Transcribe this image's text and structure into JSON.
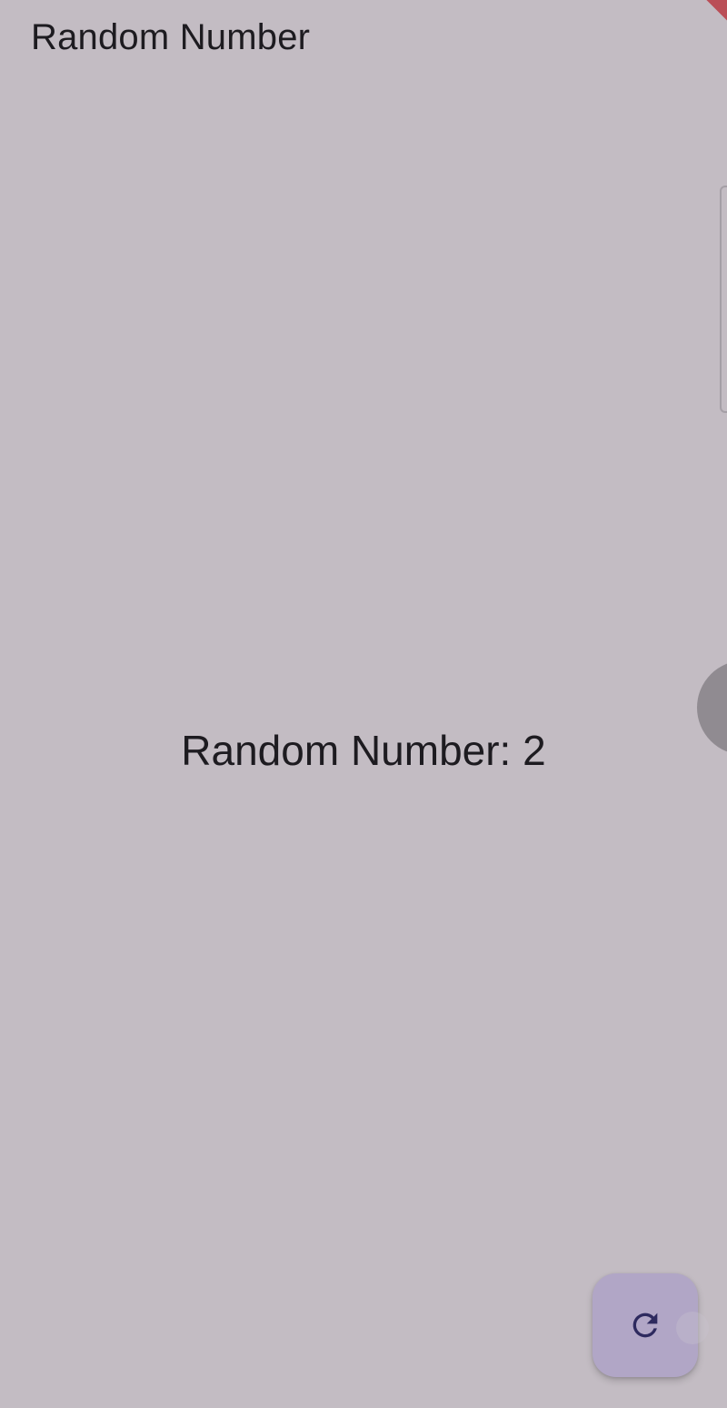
{
  "app_bar": {
    "title": "Random Number"
  },
  "main": {
    "result_text": "Random Number: 2"
  },
  "fab": {
    "icon": "refresh-icon"
  },
  "colors": {
    "background": "#c3bcc3",
    "text": "#1d1b20",
    "fab_background": "#b1a6c6",
    "fab_icon": "#2e2a5f",
    "debug_banner": "#b9414b"
  }
}
